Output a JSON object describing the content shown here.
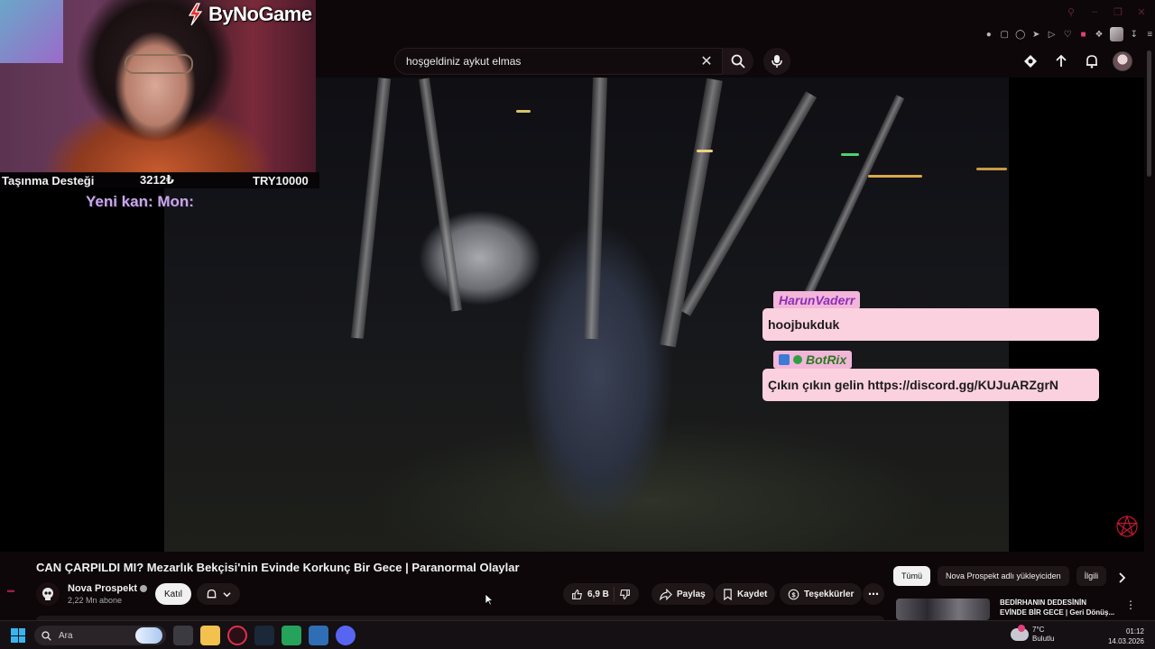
{
  "overlay": {
    "logo_text": "ByNoGame",
    "ticker": {
      "label": "Taşınma Desteği",
      "current": "3212₺",
      "goal": "TRY10000"
    },
    "ticker_sub": "Yeni kan: Mon:"
  },
  "chat": [
    {
      "user": "HarunVaderr",
      "message": "hoojbukduk",
      "name_color": "#8e2fb5"
    },
    {
      "user": "BotRix",
      "message": "Çıkın çıkın gelin https://discord.gg/KUJuARZgrN",
      "name_color": "#2a7b1f"
    }
  ],
  "search": {
    "query": "hoşgeldiniz aykut elmas"
  },
  "video": {
    "title": "CAN ÇARPILDI MI? Mezarlık Bekçisi'nin Evinde Korkunç Bir Gece | Paranormal Olaylar",
    "channel": "Nova Prospekt",
    "subscribers": "2,22 Mn abone",
    "join_label": "Katıl",
    "likes": "6,9 B",
    "share_label": "Paylaş",
    "save_label": "Kaydet",
    "thanks_label": "Teşekkürler"
  },
  "chips": [
    "Tümü",
    "Nova Prospekt adlı yükleyiciden",
    "İlgili"
  ],
  "recommendation": {
    "title_line1": "BEDİRHANIN DEDESİNİN",
    "title_line2": "EVİNDE BİR GECE | Geri Dönüş..."
  },
  "taskbar": {
    "search_placeholder": "Ara",
    "weather_temp": "7°C",
    "weather_desc": "Bulutlu",
    "time": "01:12",
    "date": "14.03.2026"
  },
  "colors": {
    "accent": "#e0407a",
    "chat_bubble": "#fbd0df",
    "chat_name_bg": "#f2b6d9",
    "ticker_sub": "#c7a8e8"
  },
  "icons": {
    "search": "search-icon",
    "mic": "mic-icon",
    "create": "create-icon",
    "upload": "upload-icon",
    "bell": "bell-icon"
  }
}
